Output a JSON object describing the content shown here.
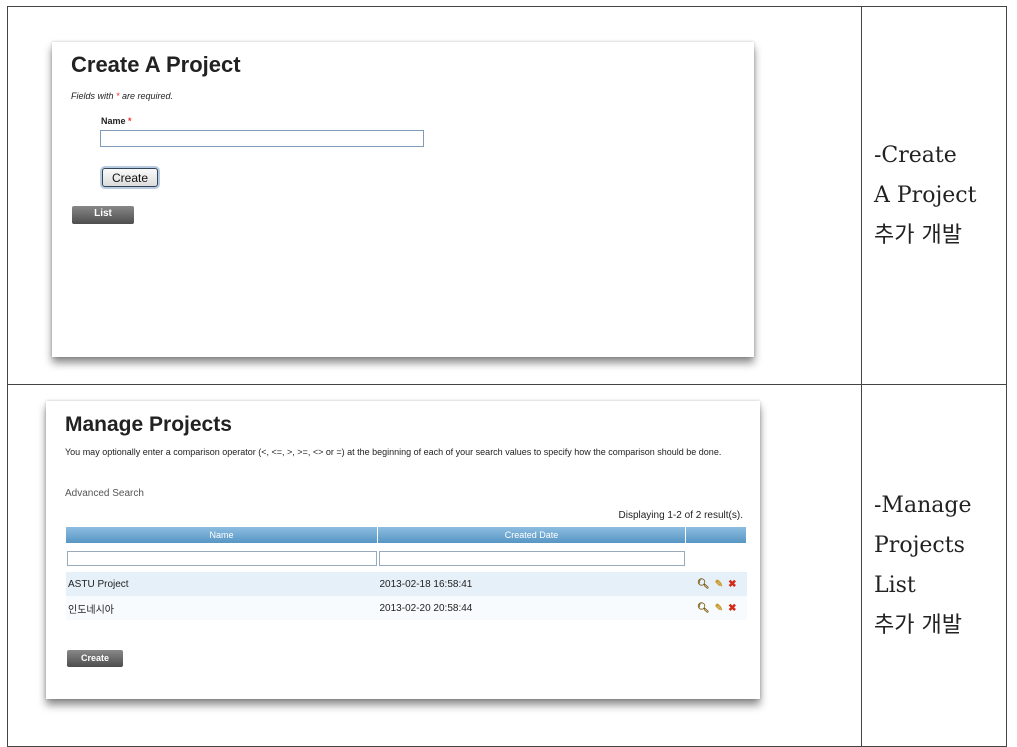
{
  "panel_create": {
    "title": "Create A Project",
    "required_note_prefix": "Fields with ",
    "required_star": "*",
    "required_note_suffix": " are required.",
    "name_label": "Name",
    "name_value": "",
    "create_label": "Create",
    "list_label": "List"
  },
  "desc_create": [
    "-Create",
    "A Project",
    "추가 개발"
  ],
  "panel_manage": {
    "title": "Manage Projects",
    "help_text": "You may optionally enter a comparison operator (<, <=, >, >=, <> or =) at the beginning of each of your search values to specify how the comparison should be done.",
    "advanced_search": "Advanced Search",
    "summary": "Displaying 1-2 of 2 result(s).",
    "columns": [
      "Name",
      "Created Date",
      ""
    ],
    "rows": [
      {
        "name": "ASTU Project",
        "created": "2013-02-18 16:58:41"
      },
      {
        "name": "인도네시아",
        "created": "2013-02-20 20:58:44"
      }
    ],
    "create_label": "Create",
    "icons": [
      "view-icon",
      "edit-icon",
      "delete-icon"
    ]
  },
  "desc_manage": [
    "-Manage",
    "Projects",
    "List",
    "추가 개발"
  ],
  "colors": {
    "header_blue": "#5796c4",
    "row_odd": "#e5f0f8",
    "delete_red": "#d42a1a"
  }
}
